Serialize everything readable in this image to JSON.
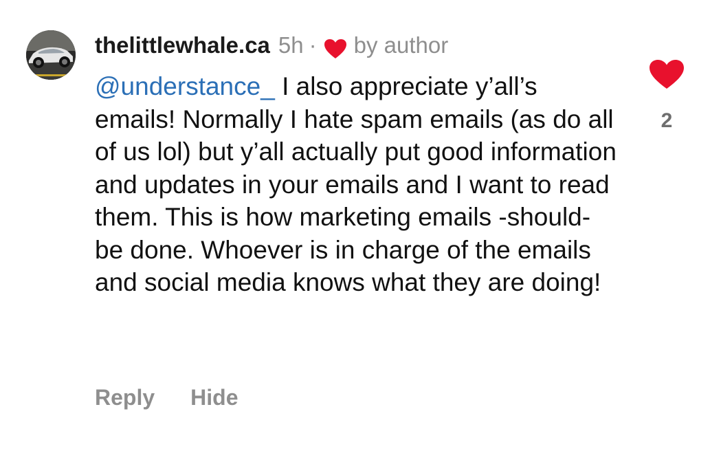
{
  "comment": {
    "username": "thelittlewhale.ca",
    "time": "5h",
    "separator": "·",
    "liked_by": "by author",
    "mention": "@understance_",
    "text": " I also appreciate y’all’s emails! Normally I hate spam emails (as do all of us lol) but y’all actually put good information and updates in your emails and I want to read them. This is how marketing emails -should- be done. Whoever is in charge of the emails and social media knows what they are doing!",
    "reply_label": "Reply",
    "hide_label": "Hide",
    "like_count": "2"
  },
  "icons": {
    "avatar": "profile-avatar-car",
    "author_like": "heart-icon",
    "like_button": "heart-icon"
  },
  "colors": {
    "heart": "#e8112d",
    "mention": "#2b6fb6",
    "muted": "#8e8e8e"
  }
}
